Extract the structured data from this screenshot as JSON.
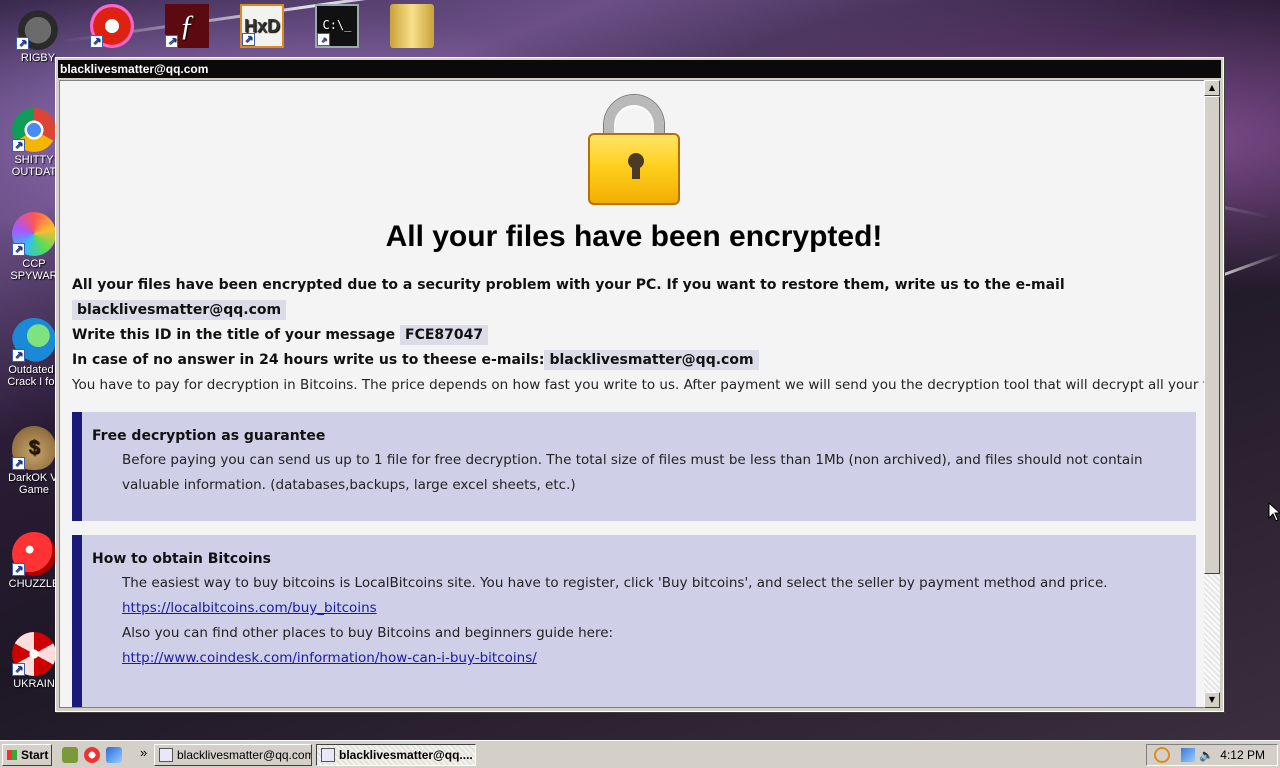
{
  "desktop_icons": [
    {
      "label": "RIGBY",
      "icon": "rigby-icon"
    },
    {
      "label": "SHITTY OUTDAT",
      "icon": "chrome-icon"
    },
    {
      "label": "CCP SPYWAR",
      "icon": "spyware-icon"
    },
    {
      "label": "Outdated I Crack I fou",
      "icon": "ie-icon"
    },
    {
      "label": "DarkOK Vi Game",
      "icon": "money-bag-icon"
    },
    {
      "label": "CHUZZLE",
      "icon": "chuzzle-icon"
    },
    {
      "label": "UKRAIN",
      "icon": "radiation-icon"
    }
  ],
  "window": {
    "title": "blacklivesmatter@qq.com"
  },
  "note": {
    "heading": "All your files have been encrypted!",
    "line1": "All your files have been encrypted due to a security problem with your PC. If you want to restore them, write us to the e-mail",
    "email": "blacklivesmatter@qq.com",
    "id_prefix": "Write this ID in the title of your message",
    "id": "FCE87047",
    "fallback_prefix": "In case of no answer in 24 hours write us to theese e-mails:",
    "fallback_email": "blacklivesmatter@qq.com",
    "payment": "You have to pay for decryption in Bitcoins. The price depends on how fast you write to us. After payment we will send you the decryption tool that will decrypt all your files.",
    "guarantee": {
      "title": "Free decryption as guarantee",
      "text": "Before paying you can send us up to 1 file for free decryption. The total size of files must be less than 1Mb (non archived), and files should not contain valuable information. (databases,backups, large excel sheets, etc.)"
    },
    "bitcoins": {
      "title": "How to obtain Bitcoins",
      "text1": "The easiest way to buy bitcoins is LocalBitcoins site. You have to register, click 'Buy bitcoins', and select the seller by payment method and price.",
      "link1": "https://localbitcoins.com/buy_bitcoins",
      "text2": "Also you can find other places to buy Bitcoins and beginners guide here:",
      "link2": "http://www.coindesk.com/information/how-can-i-buy-bitcoins/"
    }
  },
  "taskbar": {
    "start_label": "Start",
    "more": "»",
    "tasks": [
      {
        "label": "blacklivesmatter@qq.com",
        "active": false
      },
      {
        "label": "blacklivesmatter@qq....",
        "active": true
      }
    ],
    "clock": "4:12 PM"
  },
  "colors": {
    "accent_bar": "#1a1a7a",
    "box_bg": "#cfd0e8",
    "lock": "#ffd01e"
  }
}
